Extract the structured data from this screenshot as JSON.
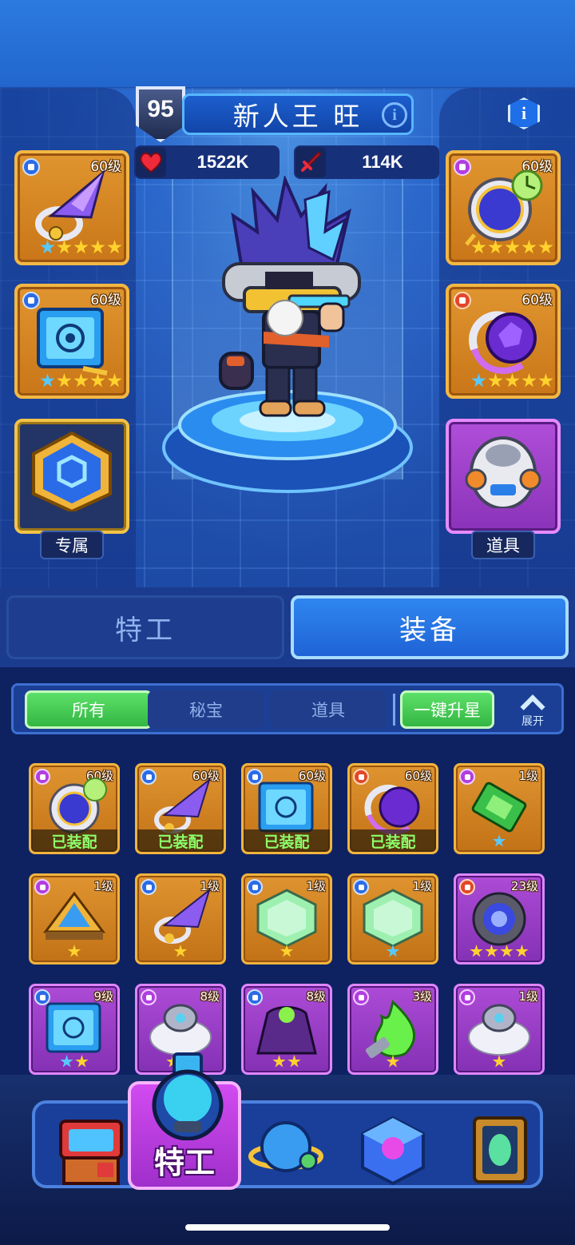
{
  "player": {
    "level": "95",
    "name": "新人王 旺",
    "hp": "1522K",
    "attack": "114K"
  },
  "icons": {
    "info": "i"
  },
  "equip_slots": {
    "left": [
      {
        "level": "60级",
        "tag": "blue",
        "stars": 4,
        "star_color": "gold",
        "item": "crystal-blade"
      },
      {
        "level": "60级",
        "tag": "blue",
        "stars": 4,
        "star_color": "gold",
        "item": "tech-cube"
      },
      {
        "label": "专属",
        "item": "hex-emblem"
      }
    ],
    "right": [
      {
        "level": "60级",
        "tag": "purple",
        "stars": 5,
        "star_color": "gold",
        "item": "pocket-watch"
      },
      {
        "level": "60级",
        "tag": "red",
        "stars": 4,
        "star_color": "gold",
        "item": "purple-orb"
      },
      {
        "label": "道具",
        "item": "capsule-robot"
      }
    ]
  },
  "tabs": {
    "agent": "特工",
    "equip": "装备"
  },
  "filters": {
    "all": "所有",
    "treasure": "秘宝",
    "prop": "道具",
    "star_up": "一键升星",
    "expand": "展开"
  },
  "inventory": [
    {
      "level": "60级",
      "tag": "purple",
      "rarity": "orange",
      "equipped": "已装配",
      "item": "pocket-watch"
    },
    {
      "level": "60级",
      "tag": "blue",
      "rarity": "orange",
      "equipped": "已装配",
      "item": "crystal-blade"
    },
    {
      "level": "60级",
      "tag": "blue",
      "rarity": "orange",
      "equipped": "已装配",
      "item": "tech-cube"
    },
    {
      "level": "60级",
      "tag": "red",
      "rarity": "orange",
      "equipped": "已装配",
      "item": "purple-orb"
    },
    {
      "level": "1级",
      "tag": "purple",
      "rarity": "orange",
      "stars": 1,
      "star_color": "blue",
      "item": "green-gem"
    },
    {
      "level": "1级",
      "tag": "purple",
      "rarity": "orange",
      "stars": 1,
      "star_color": "gold",
      "item": "pyramid"
    },
    {
      "level": "1级",
      "tag": "blue",
      "rarity": "orange",
      "stars": 1,
      "star_color": "gold",
      "item": "crystal-blade"
    },
    {
      "level": "1级",
      "tag": "blue",
      "rarity": "orange",
      "stars": 1,
      "star_color": "gold",
      "item": "jade-shield"
    },
    {
      "level": "1级",
      "tag": "blue",
      "rarity": "orange",
      "stars": 1,
      "star_color": "blue",
      "item": "jade-shield"
    },
    {
      "level": "23级",
      "tag": "red",
      "rarity": "purple",
      "stars": 4,
      "star_color": "gold",
      "item": "energy-core"
    },
    {
      "level": "9级",
      "tag": "blue",
      "rarity": "purple",
      "stars": 2,
      "star_color": "mixed",
      "item": "tech-cube"
    },
    {
      "level": "8级",
      "tag": "purple",
      "rarity": "purple",
      "stars": 2,
      "star_color": "gold",
      "item": "fur-ring"
    },
    {
      "level": "8级",
      "tag": "blue",
      "rarity": "purple",
      "stars": 2,
      "star_color": "gold",
      "item": "dark-cloak"
    },
    {
      "level": "3级",
      "tag": "purple",
      "rarity": "purple",
      "stars": 1,
      "star_color": "gold",
      "item": "green-flame"
    },
    {
      "level": "1级",
      "tag": "purple",
      "rarity": "purple",
      "stars": 1,
      "star_color": "gold",
      "item": "fur-ring"
    }
  ],
  "bottom_nav": {
    "items": [
      "shop-robot",
      "agent",
      "planet",
      "magic-cube",
      "portal"
    ],
    "active_label": "特工"
  },
  "colors": {
    "orange_rarity": "#df9430",
    "purple_rarity": "#ad4bd6",
    "equip_tab_active": "#2f86f0",
    "filter_green": "#5ce06a",
    "equipped_text": "#8cff6a"
  }
}
